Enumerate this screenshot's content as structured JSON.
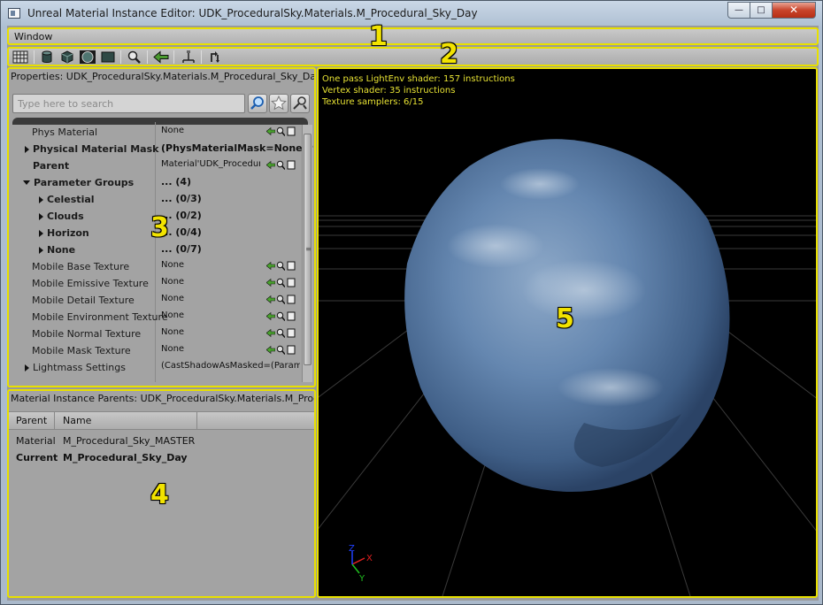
{
  "window": {
    "title": "Unreal Material Instance Editor: UDK_ProceduralSky.Materials.M_Procedural_Sky_Day",
    "controls": {
      "minimize": "minimize",
      "maximize": "maximize",
      "close": "close"
    }
  },
  "menubar": {
    "items": [
      {
        "label": "Window"
      }
    ]
  },
  "toolbar": {
    "buttons": [
      {
        "icon": "grid-icon"
      },
      {
        "icon": "cylinder-icon"
      },
      {
        "icon": "cube-icon"
      },
      {
        "icon": "sphere-icon"
      },
      {
        "icon": "plane-icon"
      },
      {
        "icon": "magnifier-icon"
      },
      {
        "icon": "back-arrow-icon"
      },
      {
        "icon": "fork-icon"
      },
      {
        "icon": "sync-icon"
      }
    ]
  },
  "properties": {
    "title": "Properties: UDK_ProceduralSky.Materials.M_Procedural_Sky_Day",
    "search_placeholder": "Type here to search",
    "rows": [
      {
        "name": "Phys Material",
        "value": "None"
      },
      {
        "name": "Physical Material Mask",
        "value": "(PhysMaterialMask=None,P"
      },
      {
        "name": "Parent",
        "value": "Material'UDK_Procedur"
      },
      {
        "name": "Parameter Groups",
        "value": "... (4)"
      },
      {
        "name": "Celestial",
        "value": "... (0/3)"
      },
      {
        "name": "Clouds",
        "value": "... (0/2)"
      },
      {
        "name": "Horizon",
        "value": "... (0/4)"
      },
      {
        "name": "None",
        "value": "... (0/7)"
      },
      {
        "name": "Mobile Base Texture",
        "value": "None"
      },
      {
        "name": "Mobile Emissive Texture",
        "value": "None"
      },
      {
        "name": "Mobile Detail Texture",
        "value": "None"
      },
      {
        "name": "Mobile Environment Texture",
        "value": "None"
      },
      {
        "name": "Mobile Normal Texture",
        "value": "None"
      },
      {
        "name": "Mobile Mask Texture",
        "value": "None"
      },
      {
        "name": "Lightmass Settings",
        "value": "(CastShadowAsMasked=(Param"
      }
    ]
  },
  "parents": {
    "title": "Material Instance Parents: UDK_ProceduralSky.Materials.M_Proc...",
    "columns": [
      "Parent",
      "Name"
    ],
    "rows": [
      {
        "parent": "Material",
        "name": "M_Procedural_Sky_MASTER"
      },
      {
        "parent": "Current",
        "name": "M_Procedural_Sky_Day"
      }
    ]
  },
  "viewport": {
    "stats": [
      "One pass LightEnv shader: 157 instructions",
      "Vertex shader: 35 instructions",
      "Texture samplers: 6/15"
    ],
    "axes": {
      "x": "X",
      "y": "Y",
      "z": "Z"
    }
  },
  "annotations": [
    "1",
    "2",
    "3",
    "4",
    "5"
  ],
  "colors": {
    "annotation": "#f2e300",
    "stats_text": "#e6e133",
    "sphere": "#5b7ba3",
    "close_button": "#c9442b"
  }
}
